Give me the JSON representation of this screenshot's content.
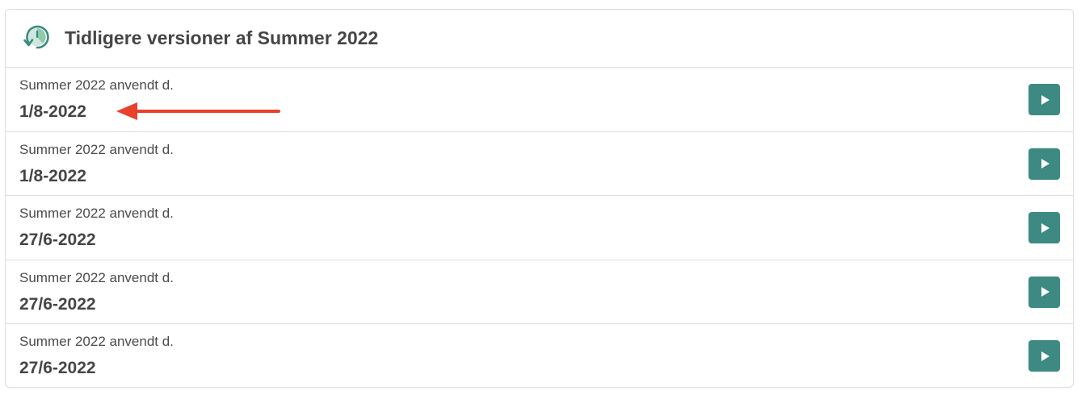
{
  "panel": {
    "title": "Tidligere versioner af Summer 2022",
    "icon": "history-icon"
  },
  "versions": [
    {
      "label": "Summer 2022 anvendt d.",
      "date": "1/8-2022",
      "action_icon": "play-icon"
    },
    {
      "label": "Summer 2022 anvendt d.",
      "date": "1/8-2022",
      "action_icon": "play-icon"
    },
    {
      "label": "Summer 2022 anvendt d.",
      "date": "27/6-2022",
      "action_icon": "play-icon"
    },
    {
      "label": "Summer 2022 anvendt d.",
      "date": "27/6-2022",
      "action_icon": "play-icon"
    },
    {
      "label": "Summer 2022 anvendt d.",
      "date": "27/6-2022",
      "action_icon": "play-icon"
    }
  ],
  "colors": {
    "accent": "#3d8a82",
    "annotation": "#e8412c",
    "text": "#454545",
    "border": "#dcdcdc"
  }
}
